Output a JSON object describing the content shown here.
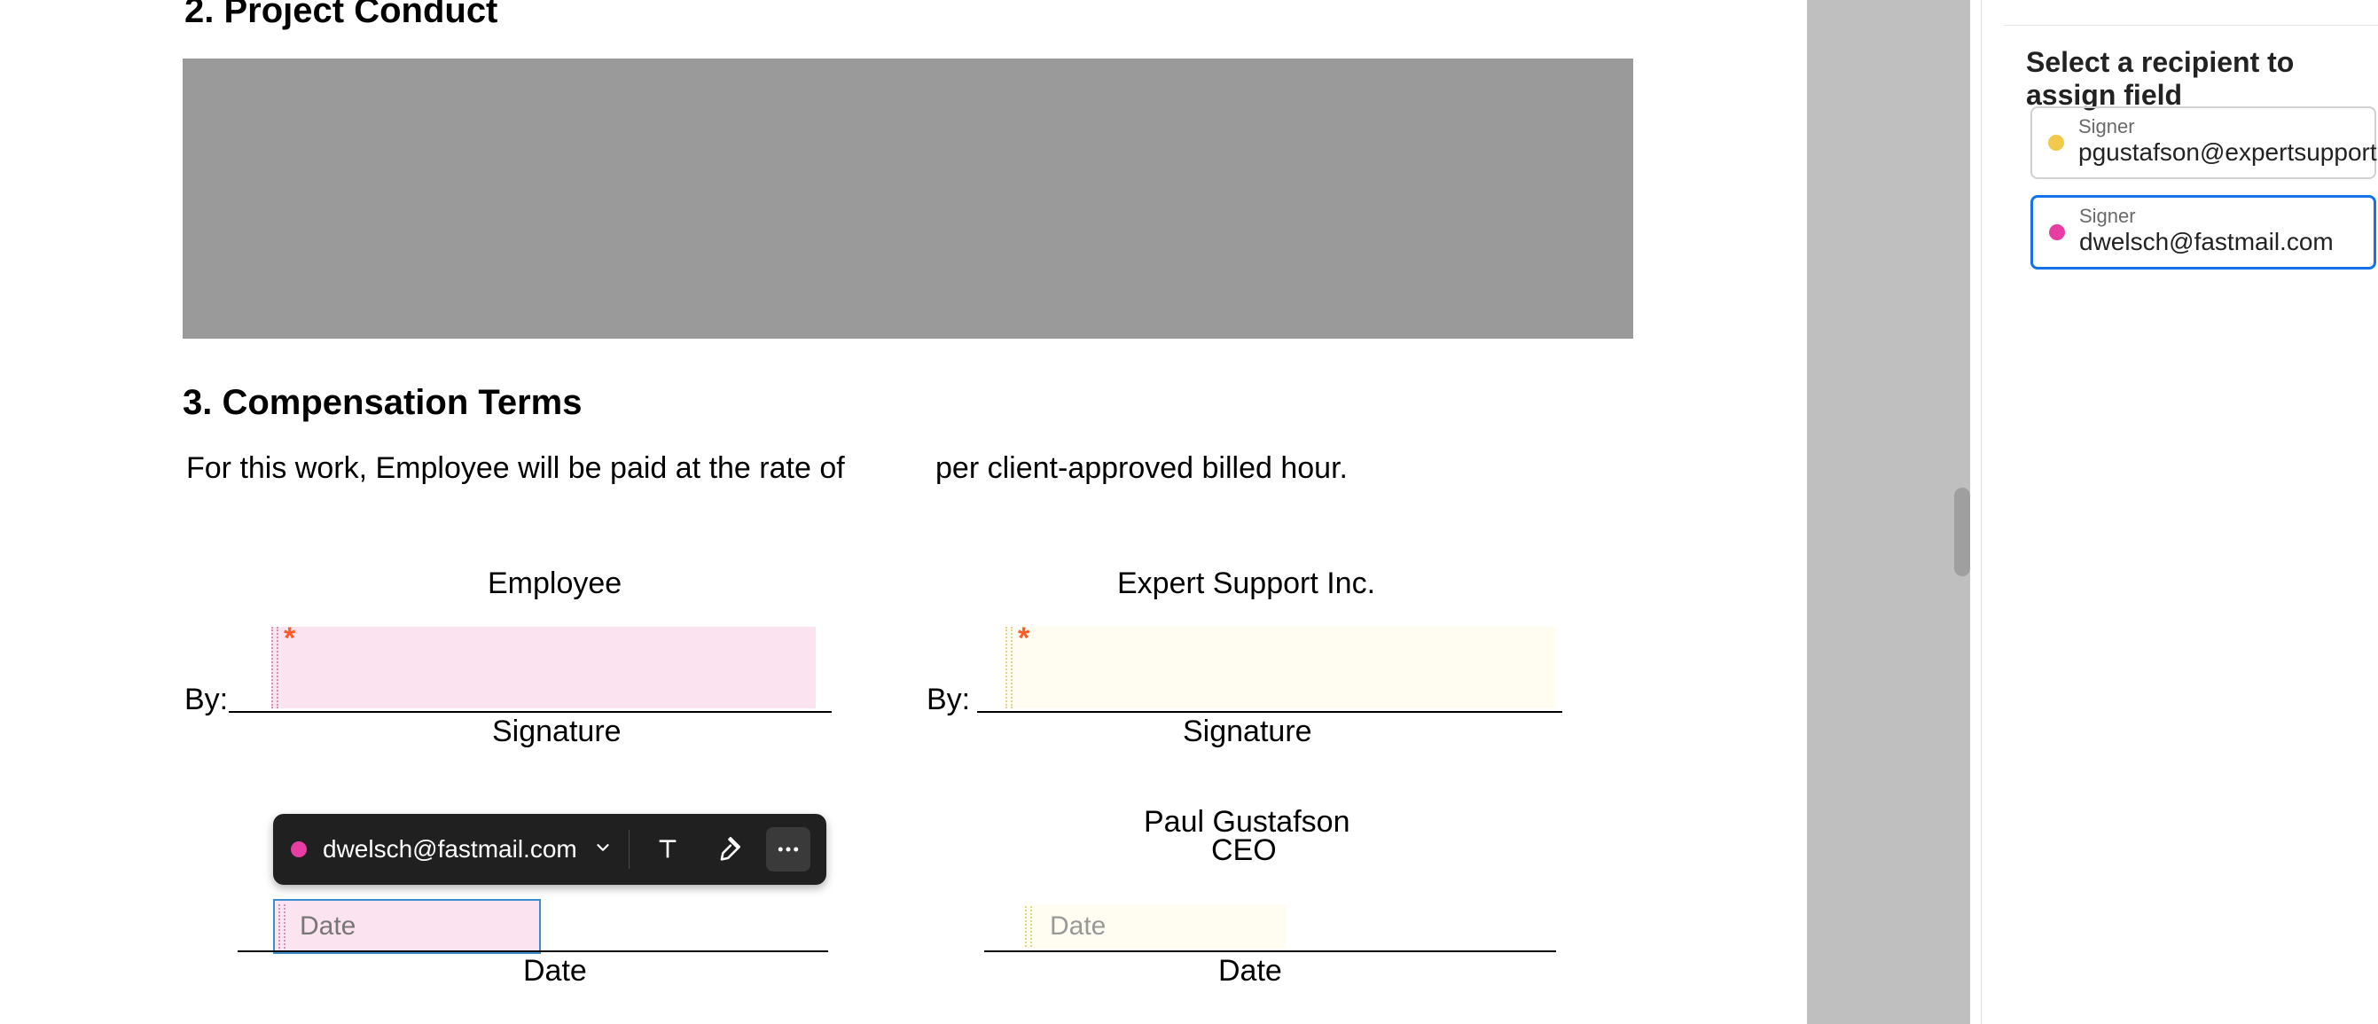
{
  "document": {
    "section2_heading": "2. Project Conduct",
    "section3_heading": "3. Compensation Terms",
    "comp_text_a": "For this work, Employee will be paid at the rate of",
    "comp_text_b": "per client-approved billed hour.",
    "employee_header": "Employee",
    "company_header": "Expert Support Inc.",
    "by_label_left": "By:",
    "by_label_right": "By:",
    "signature_caption_left": "Signature",
    "signature_caption_right": "Signature",
    "ceo_name": "Paul Gustafson",
    "ceo_title": "CEO",
    "date_caption_left": "Date",
    "date_caption_right": "Date",
    "required_mark": "*",
    "date_placeholder_left": "Date",
    "date_placeholder_right": "Date"
  },
  "field_toolbar": {
    "assigned_recipient": "dwelsch@fastmail.com",
    "color": "#e83ea3"
  },
  "side_panel": {
    "heading": "Select a recipient to assign field",
    "recipients": [
      {
        "role": "Signer",
        "email": "pgustafson@expertsupport.com",
        "color": "#f2c94c",
        "selected": false
      },
      {
        "role": "Signer",
        "email": "dwelsch@fastmail.com",
        "color": "#e83ea3",
        "selected": true
      }
    ]
  }
}
